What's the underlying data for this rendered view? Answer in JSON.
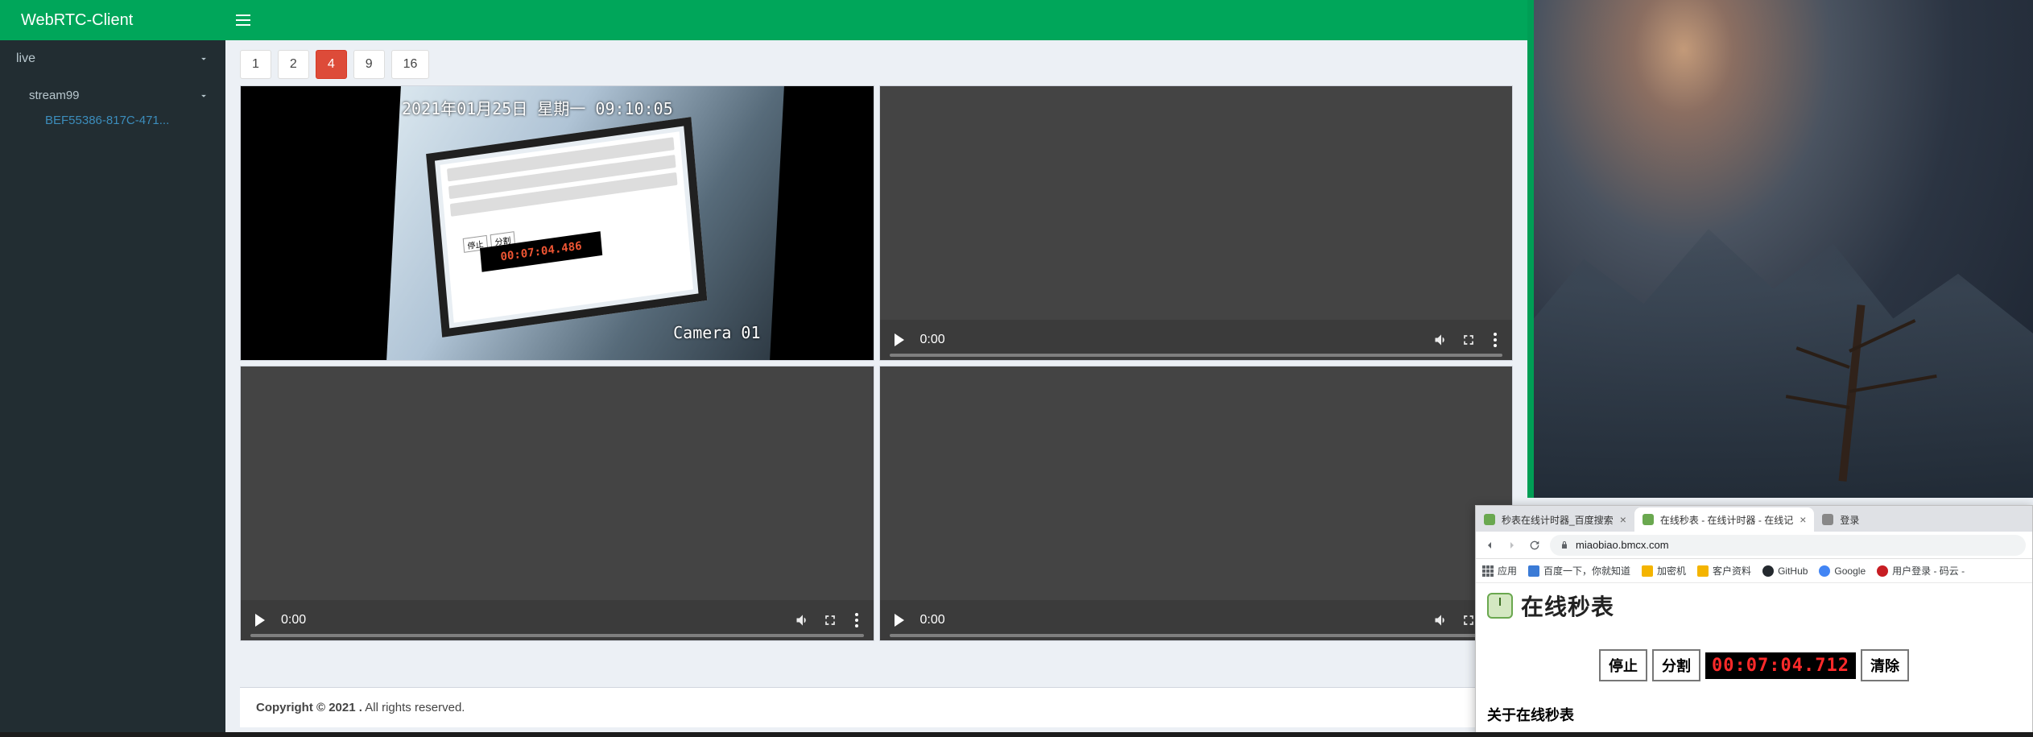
{
  "brand": "WebRTC-Client",
  "sidebar": {
    "items": [
      {
        "label": "live"
      },
      {
        "label": "stream99"
      },
      {
        "label": "BEF55386-817C-471..."
      }
    ]
  },
  "layouts": [
    "1",
    "2",
    "4",
    "9",
    "16"
  ],
  "active_layout": "4",
  "camera": {
    "timestamp": "2021年01月25日  星期一  09:10:05",
    "label": "Camera  01",
    "inner_buttons": [
      "停止",
      "分割"
    ],
    "inner_timer": "00:07:04.486"
  },
  "video_time": "0:00",
  "footer": {
    "copyright": "Copyright © 2021 .",
    "rights": " All rights reserved."
  },
  "browser": {
    "tabs": [
      {
        "title": "秒表在线计时器_百度搜索",
        "active": false
      },
      {
        "title": "在线秒表 - 在线计时器 - 在线记",
        "active": true
      },
      {
        "title": "登录",
        "active": false
      }
    ],
    "url": "miaobiao.bmcx.com",
    "bookmarks": {
      "apps": "应用",
      "items": [
        {
          "label": "百度一下，你就知道",
          "color": "#3b7bd6"
        },
        {
          "label": "加密机",
          "color": "#f4b400"
        },
        {
          "label": "客户资料",
          "color": "#f4b400"
        },
        {
          "label": "GitHub",
          "color": "#24292e"
        },
        {
          "label": "Google",
          "color": "#4285f4"
        },
        {
          "label": "用户登录 - 码云 -",
          "color": "#c71d23"
        }
      ]
    },
    "page": {
      "title": "在线秒表",
      "buttons": {
        "stop": "停止",
        "split": "分割",
        "clear": "清除"
      },
      "timer": "00:07:04.712",
      "about": "关于在线秒表"
    }
  }
}
